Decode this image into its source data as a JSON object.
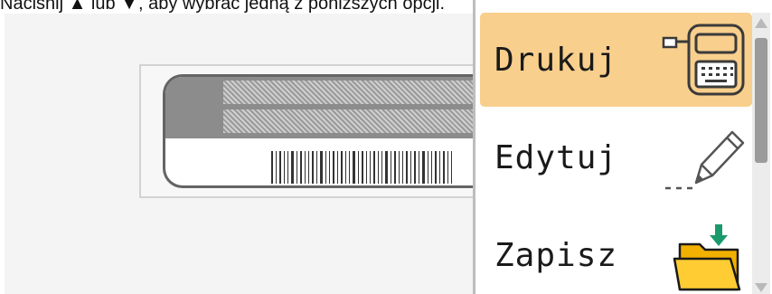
{
  "instruction": {
    "prefix": "Naciśnij ",
    "key1": "▲",
    "middle": " lub ▼, aby wybrać jedną z poniższych opcji."
  },
  "menu": {
    "items": [
      {
        "label": "Drukuj",
        "icon": "printer-icon",
        "selected": true
      },
      {
        "label": "Edytuj",
        "icon": "pencil-icon",
        "selected": false
      },
      {
        "label": "Zapisz",
        "icon": "folder-save-icon",
        "selected": false
      }
    ]
  },
  "colors": {
    "selected_bg": "#f8cf8c",
    "folder": "#f5b800",
    "arrow_green": "#1a9a6c"
  }
}
